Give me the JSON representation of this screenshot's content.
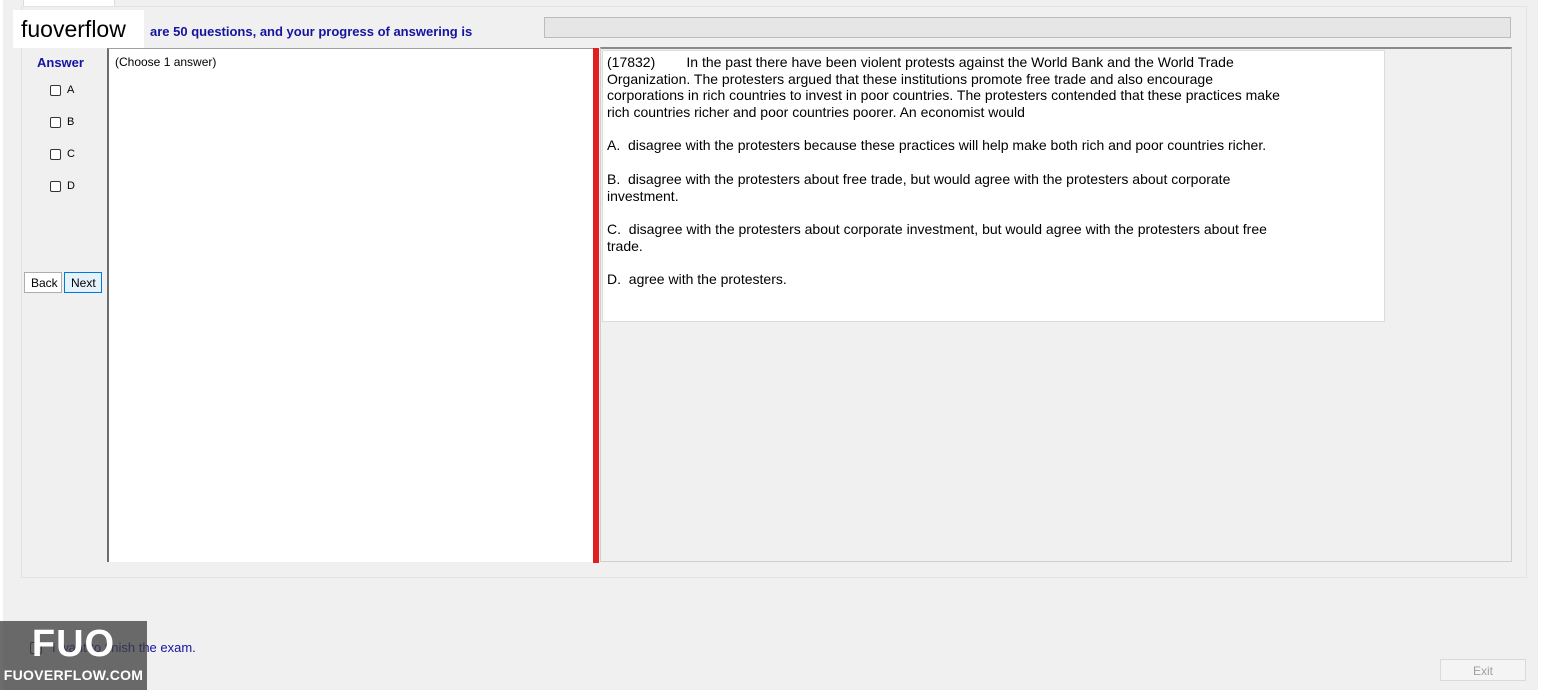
{
  "header": {
    "logo_text": "fuoverflow",
    "progress_text": "are 50 questions, and your progress of answering is",
    "progress_value": 0
  },
  "answer_panel": {
    "label": "Answer",
    "options": [
      "A",
      "B",
      "C",
      "D"
    ],
    "back_label": "Back",
    "next_label": "Next"
  },
  "choose_panel": {
    "instruction": "(Choose 1 answer)"
  },
  "question": {
    "stem_lines": [
      "(17832)        In the past there have been violent protests against the World Bank and the World Trade",
      "Organization. The protesters argued that these institutions promote free trade and also encourage",
      "corporations in rich countries to invest in poor countries. The protesters contended that these practices make",
      "rich countries richer and poor countries poorer. An economist would"
    ],
    "options": [
      {
        "lines": [
          "A.  disagree with the protesters because these practices will help make both rich and poor countries richer."
        ]
      },
      {
        "lines": [
          "B.  disagree with the protesters about free trade, but would agree with the protesters about corporate",
          "investment."
        ]
      },
      {
        "lines": [
          "C.  disagree with the protesters about corporate investment, but would agree with the protesters about free",
          "trade."
        ]
      },
      {
        "lines": [
          "D.  agree with the protesters."
        ]
      }
    ]
  },
  "footer": {
    "finish_label": "I want to finish the exam.",
    "exit_label": "Exit"
  },
  "watermark": {
    "big": "FUO",
    "small": "FUOVERFLOW.COM"
  },
  "colors": {
    "label_blue": "#1414a0",
    "splitter_red": "#e02020",
    "progress_green": "#06b025"
  }
}
